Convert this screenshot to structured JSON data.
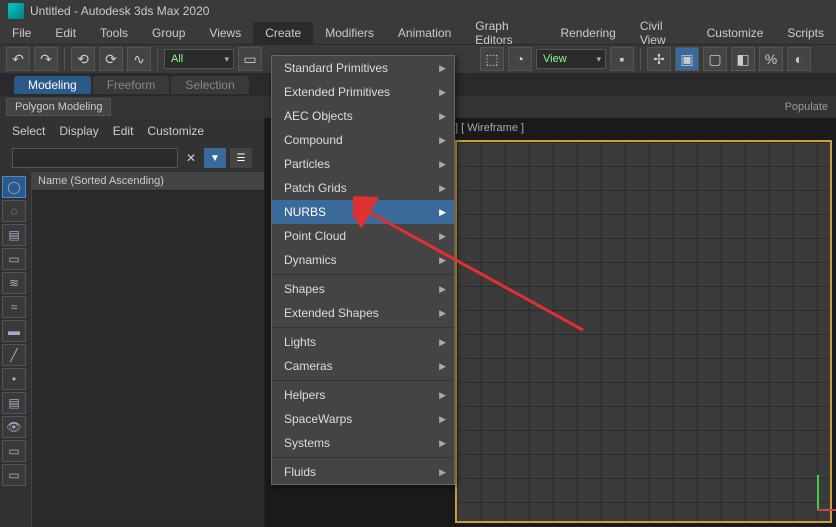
{
  "title": "Untitled - Autodesk 3ds Max 2020",
  "menubar": [
    "File",
    "Edit",
    "Tools",
    "Group",
    "Views",
    "Create",
    "Modifiers",
    "Animation",
    "Graph Editors",
    "Rendering",
    "Civil View",
    "Customize",
    "Scripts"
  ],
  "active_menu_index": 5,
  "toolbar": {
    "filter_combo": "All",
    "view_combo": "View"
  },
  "tabs": {
    "items": [
      "Modeling",
      "Freeform",
      "Selection"
    ],
    "active": 0
  },
  "ribbon_label": "Polygon Modeling",
  "populate_label": "Populate",
  "left": {
    "menu": [
      "Select",
      "Display",
      "Edit",
      "Customize"
    ],
    "search_placeholder": "",
    "name_header": "Name (Sorted Ascending)",
    "icons": [
      "circle",
      "bulb",
      "cam",
      "rect",
      "waves",
      "waves2",
      "rect2",
      "diag",
      "point",
      "layers",
      "eye",
      "rect3",
      "rect4"
    ]
  },
  "viewport_label": "] [ Wireframe ]",
  "dropdown": {
    "groups": [
      [
        "Standard Primitives",
        "Extended Primitives",
        "AEC Objects",
        "Compound",
        "Particles",
        "Patch Grids",
        "NURBS",
        "Point Cloud",
        "Dynamics"
      ],
      [
        "Shapes",
        "Extended Shapes"
      ],
      [
        "Lights",
        "Cameras"
      ],
      [
        "Helpers",
        "SpaceWarps",
        "Systems"
      ],
      [
        "Fluids"
      ]
    ],
    "highlighted": "NURBS"
  },
  "watermark": ""
}
